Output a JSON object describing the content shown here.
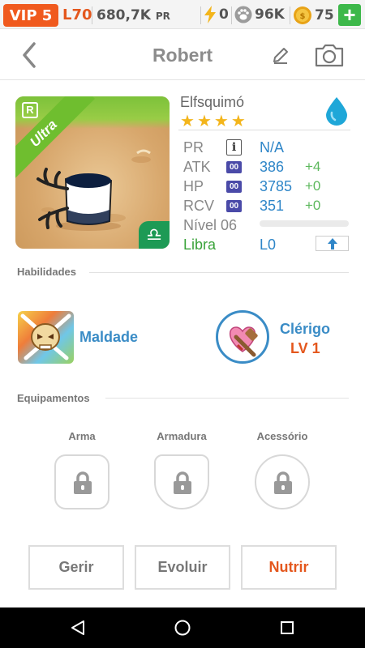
{
  "status_bar": {
    "vip": "VIP 5",
    "level": "L70",
    "pr_value": "680,7K",
    "pr_unit": "PR",
    "energy": "0",
    "paws": "96K",
    "coins": "75",
    "add_label": "+"
  },
  "header": {
    "title": "Robert"
  },
  "pet": {
    "rarity_letter": "R",
    "rarity": "Ultra",
    "name": "Elfsquimó",
    "stars": 4,
    "pr_label": "PR",
    "pr_value": "N/A",
    "info_icon_label": "i",
    "stats": [
      {
        "label": "ATK",
        "badge": "00",
        "value": "386",
        "bonus": "+4"
      },
      {
        "label": "HP",
        "badge": "00",
        "value": "3785",
        "bonus": "+0"
      },
      {
        "label": "RCV",
        "badge": "00",
        "value": "351",
        "bonus": "+0"
      }
    ],
    "level_label": "Nível 06",
    "xp_fraction": 0.0,
    "zodiac": "Libra",
    "zodiac_symbol": "♎",
    "zodiac_level": "L0"
  },
  "abilities": {
    "section_title": "Habilidades",
    "skill_name": "Maldade",
    "class_name": "Clérigo",
    "class_level": "LV 1"
  },
  "equipment": {
    "section_title": "Equipamentos",
    "slots": [
      "Arma",
      "Armadura",
      "Acessório"
    ]
  },
  "actions": {
    "manage": "Gerir",
    "evolve": "Evoluir",
    "feed": "Nutrir"
  },
  "colors": {
    "accent_orange": "#e4571d",
    "accent_blue": "#3a8cc6",
    "green": "#3aa33a",
    "vip_bg": "#f05a1e"
  }
}
